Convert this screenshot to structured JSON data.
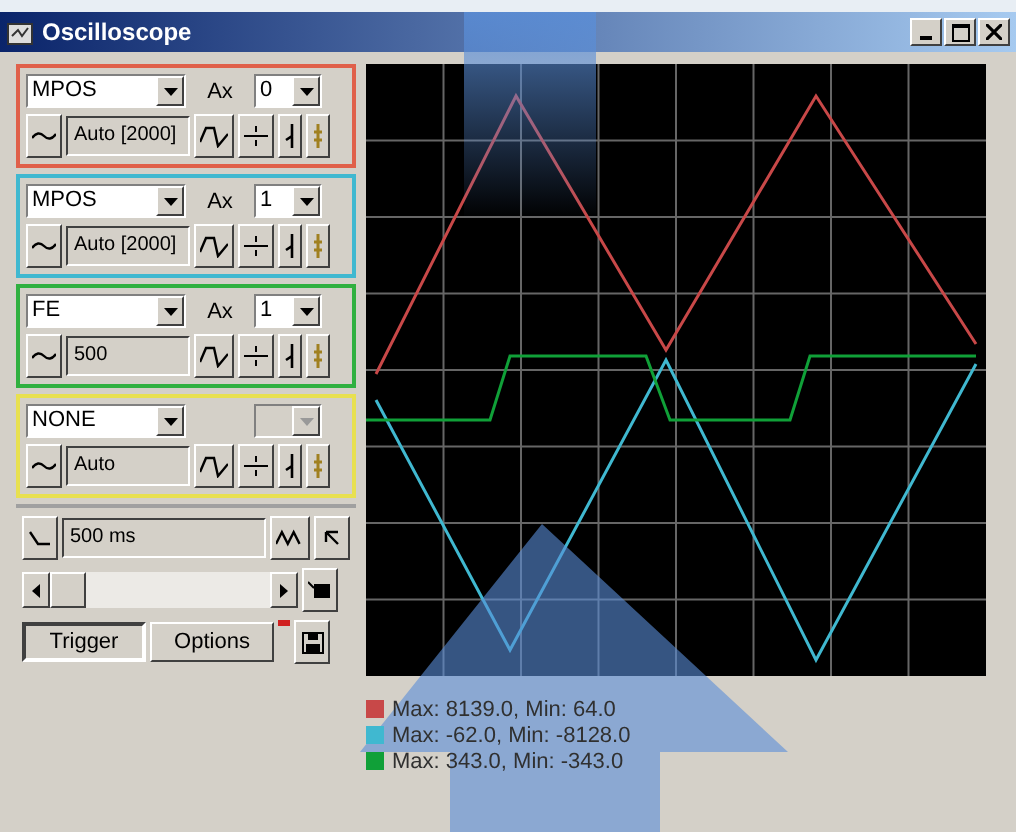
{
  "window": {
    "title": "Oscilloscope"
  },
  "channels": [
    {
      "signal": "MPOS",
      "axis_label": "Ax",
      "axis": "0",
      "axis_disabled": false,
      "scale": "Auto [2000]",
      "color": "#e0604a"
    },
    {
      "signal": "MPOS",
      "axis_label": "Ax",
      "axis": "1",
      "axis_disabled": false,
      "scale": "Auto [2000]",
      "color": "#40b8d0"
    },
    {
      "signal": "FE",
      "axis_label": "Ax",
      "axis": "1",
      "axis_disabled": false,
      "scale": "500",
      "color": "#30b040"
    },
    {
      "signal": "NONE",
      "axis_disabled": true,
      "scale": "Auto",
      "color": "#e8e050"
    }
  ],
  "timebase": {
    "value": "500 ms"
  },
  "buttons": [
    {
      "label": "Trigger",
      "pressed": true
    },
    {
      "label": "Options",
      "pressed": false
    }
  ],
  "legend": [
    {
      "text": "Max: 8139.0, Min: 64.0",
      "color": "#c84848"
    },
    {
      "text": "Max: -62.0, Min: -8128.0",
      "color": "#40b8d0"
    },
    {
      "text": "Max: 343.0, Min: -343.0",
      "color": "#10a038"
    }
  ]
}
